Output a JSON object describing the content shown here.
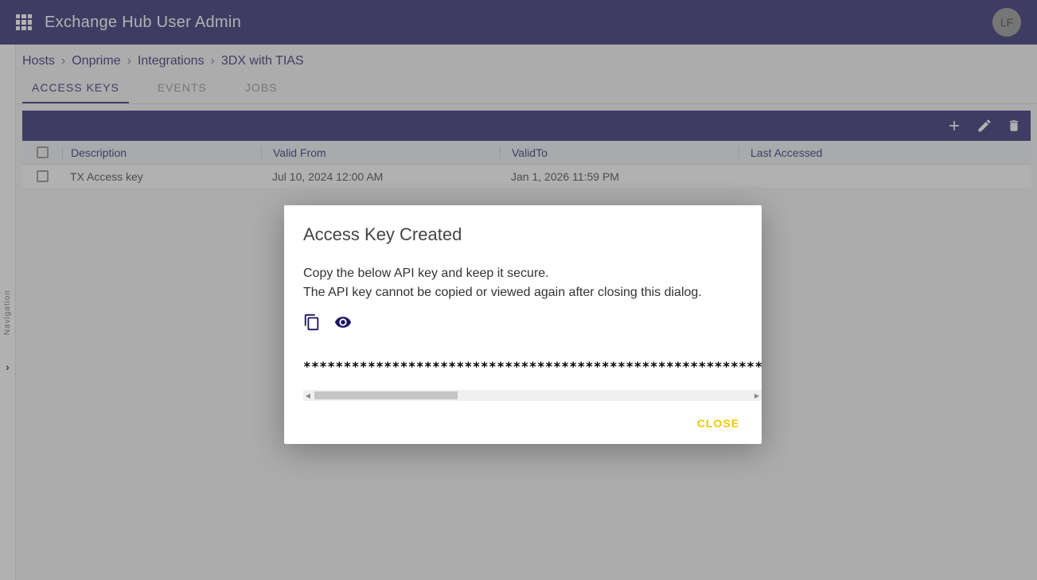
{
  "header": {
    "title": "Exchange Hub User Admin",
    "avatar_initials": "LF"
  },
  "sidebar": {
    "label": "Navigation"
  },
  "breadcrumb": {
    "items": [
      "Hosts",
      "Onprime",
      "Integrations",
      "3DX with TIAS"
    ],
    "separator": "›"
  },
  "tabs": {
    "access_keys": "ACCESS KEYS",
    "events": "EVENTS",
    "jobs": "JOBS"
  },
  "table": {
    "headers": {
      "description": "Description",
      "valid_from": "Valid From",
      "valid_to": "ValidTo",
      "last_accessed": "Last Accessed"
    },
    "rows": [
      {
        "description": "TX Access key",
        "valid_from": "Jul 10, 2024 12:00 AM",
        "valid_to": "Jan 1, 2026 11:59 PM",
        "last_accessed": ""
      }
    ]
  },
  "dialog": {
    "title": "Access Key Created",
    "line1": "Copy the below API key and keep it secure.",
    "line2": "The API key cannot be copied or viewed again after closing this dialog.",
    "masked_key": "***************************************************************",
    "close_label": "CLOSE"
  }
}
